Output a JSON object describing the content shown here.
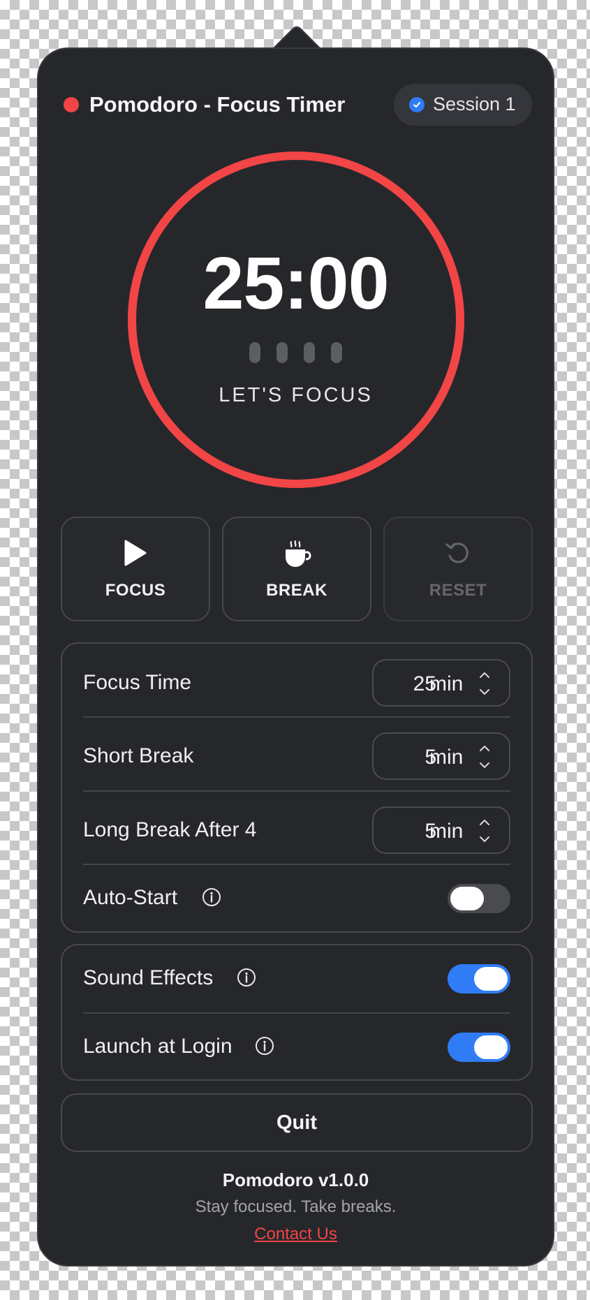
{
  "colors": {
    "accent_red": "#f24545",
    "accent_blue": "#2f7cf6",
    "toggle_off": "#4a4b50"
  },
  "header": {
    "title": "Pomodoro - Focus Timer",
    "session_label": "Session 1",
    "status_icon": "red-dot-icon",
    "session_icon": "check-circle-icon"
  },
  "timer": {
    "time": "25:00",
    "mode_label": "LET'S FOCUS",
    "session_dots": 4,
    "progress": 1.0
  },
  "controls": [
    {
      "label": "FOCUS",
      "icon": "play-icon",
      "enabled": true
    },
    {
      "label": "BREAK",
      "icon": "coffee-cup-icon",
      "enabled": true
    },
    {
      "label": "RESET",
      "icon": "reset-icon",
      "enabled": false
    }
  ],
  "settings": {
    "focus_time": {
      "label": "Focus Time",
      "value": "25",
      "unit": "min"
    },
    "short_break": {
      "label": "Short Break",
      "value": "5",
      "unit": "min"
    },
    "long_break": {
      "label": "Long Break After 4",
      "value": "5",
      "unit": "min"
    },
    "auto_start": {
      "label": "Auto-Start",
      "on": false
    }
  },
  "preferences": {
    "sound_effects": {
      "label": "Sound Effects",
      "on": true
    },
    "launch_at_login": {
      "label": "Launch at Login",
      "on": true
    }
  },
  "quit_label": "Quit",
  "footer": {
    "title": "Pomodoro v1.0.0",
    "tagline": "Stay focused. Take breaks.",
    "link": "Contact Us"
  }
}
